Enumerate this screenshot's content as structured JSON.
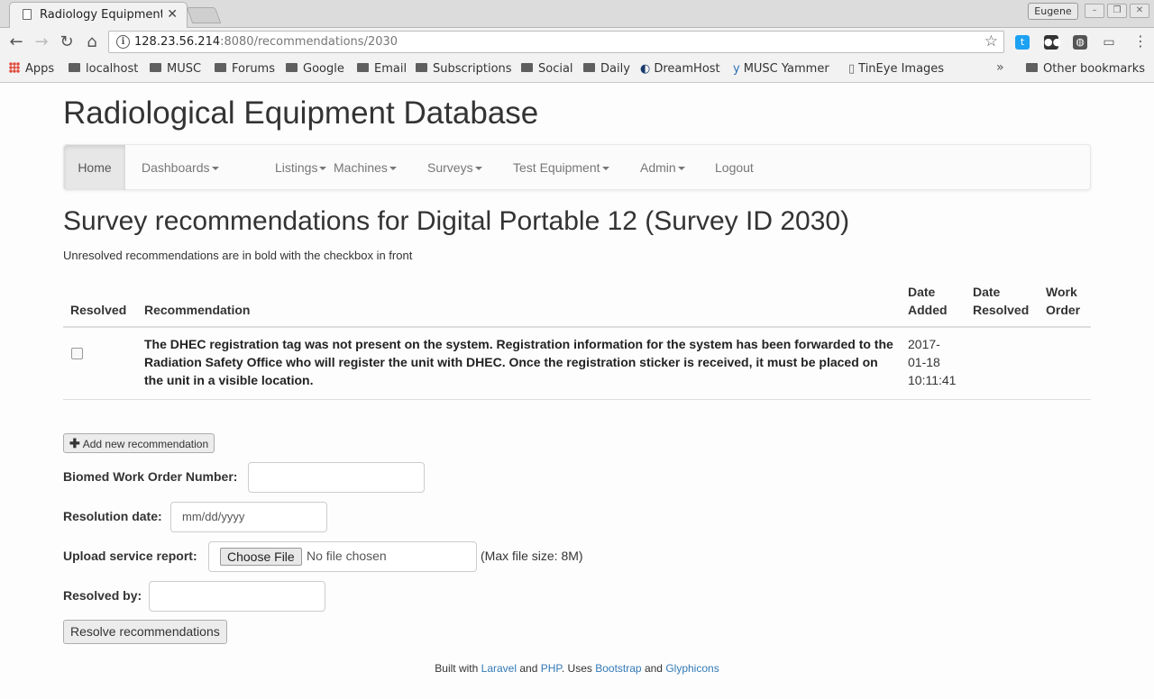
{
  "browser": {
    "tab_title": "Radiology Equipment",
    "profile": "Eugene",
    "url_host": "128.23.56.214",
    "url_rest": ":8080/recommendations/2030",
    "bookmarks": [
      "Apps",
      "localhost",
      "MUSC",
      "Forums",
      "Google",
      "Email",
      "Subscriptions",
      "Social",
      "Daily",
      "DreamHost",
      "MUSC Yammer",
      "TinEye Images"
    ],
    "other_bookmarks": "Other bookmarks"
  },
  "site": {
    "title": "Radiological Equipment Database",
    "nav": {
      "home": "Home",
      "items": [
        "Dashboards",
        "Listings",
        "Machines",
        "Surveys",
        "Test Equipment",
        "Admin"
      ],
      "logout": "Logout"
    }
  },
  "main": {
    "heading": "Survey recommendations for Digital Portable 12 (Survey ID 2030)",
    "intro": "Unresolved recommendations are in bold with the checkbox in front",
    "table": {
      "headers": {
        "resolved": "Resolved",
        "recommendation": "Recommendation",
        "date_added_1": "Date",
        "date_added_2": "Added",
        "date_resolved_1": "Date",
        "date_resolved_2": "Resolved",
        "work_order_1": "Work",
        "work_order_2": "Order"
      },
      "rows": [
        {
          "recommendation": "The DHEC registration tag was not present on the system. Registration information for the system has been forwarded to the Radiation Safety Office who will register the unit with DHEC. Once the registration sticker is received, it must be placed on the unit in a visible location.",
          "date_added_1": "2017-",
          "date_added_2": "01-18",
          "date_added_3": "10:11:41",
          "date_resolved": "",
          "work_order": "",
          "resolved": false
        }
      ]
    },
    "add_button": "Add new recommendation",
    "form": {
      "work_order_label": "Biomed Work Order Number:",
      "work_order_value": "",
      "resolution_date_label": "Resolution date:",
      "resolution_date_placeholder": "mm/dd/yyyy",
      "upload_label": "Upload service report:",
      "choose_file": "Choose File",
      "no_file": "No file chosen",
      "max_size": "(Max file size: 8M)",
      "resolved_by_label": "Resolved by:",
      "resolved_by_value": ""
    },
    "resolve_button": "Resolve recommendations"
  },
  "footer": {
    "prefix": "Built with",
    "laravel": "Laravel",
    "and1": "and",
    "php": "PHP",
    "uses": ". Uses",
    "bootstrap": "Bootstrap",
    "and2": "and",
    "glyphicons": "Glyphicons"
  }
}
